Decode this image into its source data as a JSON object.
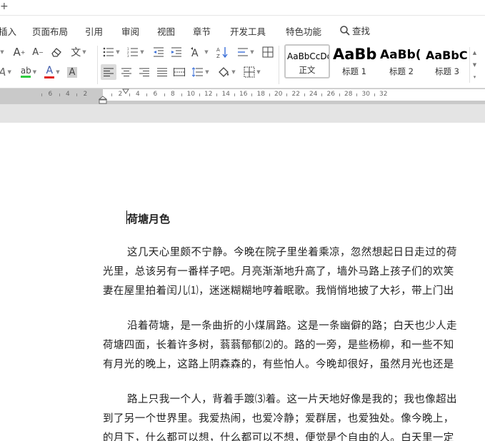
{
  "topbar": {
    "plus_glyph": "+"
  },
  "tabs": {
    "items": [
      "插入",
      "页面布局",
      "引用",
      "审阅",
      "视图",
      "章节",
      "开发工具",
      "特色功能"
    ],
    "search_label": "查找"
  },
  "styles": {
    "items": [
      {
        "sample": "AaBbCcDd",
        "name": "正文"
      },
      {
        "sample": "AaBb",
        "name": "标题 1"
      },
      {
        "sample": "AaBb(",
        "name": "标题 2"
      },
      {
        "sample": "AaBbC",
        "name": "标题 3"
      }
    ]
  },
  "toolbar": {
    "pinyin_glyph": "文",
    "highlight_glyph": "ab",
    "fontcolor_glyph": "A",
    "charshade_glyph": "A",
    "grow_glyph": "A",
    "shrink_glyph": "A",
    "colors": {
      "highlight": "#2ecc40",
      "font": "#e0201b"
    }
  },
  "ruler": {
    "labels": [
      "6",
      "4",
      "2",
      "2",
      "4",
      "6",
      "8",
      "10",
      "12",
      "14",
      "16",
      "18",
      "20",
      "22",
      "24",
      "26",
      "28",
      "30",
      "32"
    ]
  },
  "document": {
    "title": "荷塘月色",
    "lines": [
      "这几天心里颇不宁静。今晚在院子里坐着乘凉，忽然想起日日走过的荷",
      "光里，总该另有一番样子吧。月亮渐渐地升高了，墙外马路上孩子们的欢笑",
      "妻在屋里拍着闰儿⑴，迷迷糊糊地哼着眠歌。我悄悄地披了大衫，带上门出",
      "沿着荷塘，是一条曲折的小煤屑路。这是一条幽僻的路；白天也少人走",
      "荷塘四面，长着许多树，蓊蓊郁郁⑵的。路的一旁，是些杨柳，和一些不知",
      "有月光的晚上，这路上阴森森的，有些怕人。今晚却很好，虽然月光也还是",
      "路上只我一个人，背着手踱⑶着。这一片天地好像是我的；我也像超出",
      "到了另一个世界里。我爱热闹，也爱冷静；爱群居，也爱独处。像今晚上，",
      "的月下，什么都可以想，什么都可以不想，便觉是个自由的人。白天里一定"
    ]
  }
}
